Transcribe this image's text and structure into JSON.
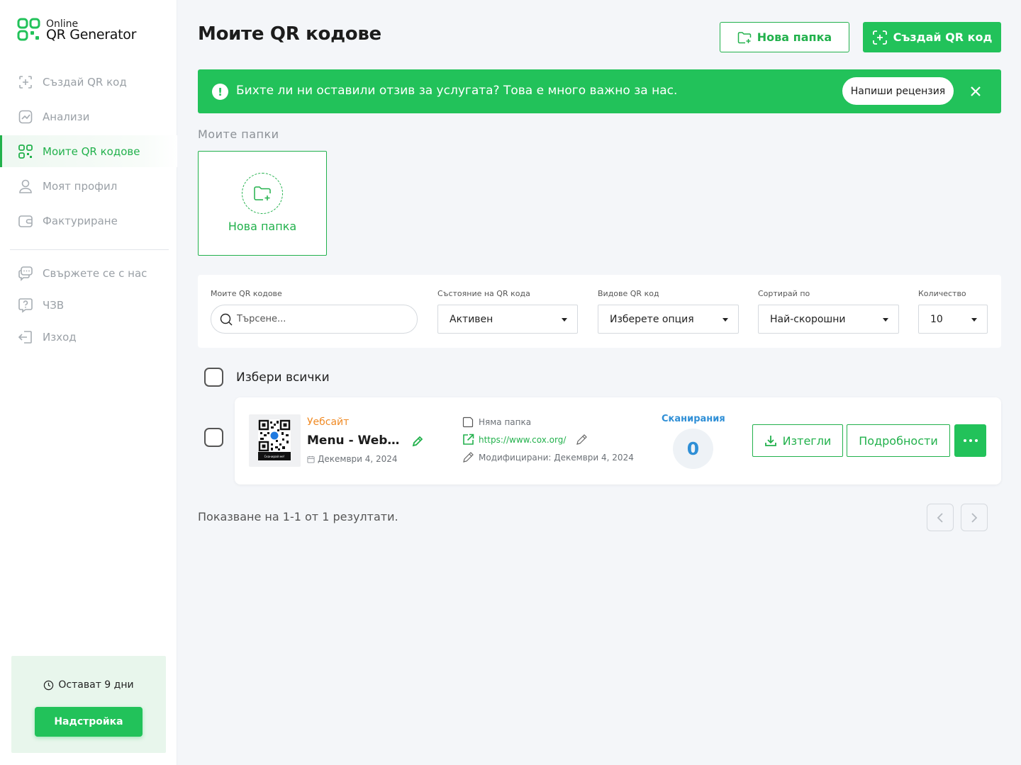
{
  "brand": {
    "line1": "Online",
    "line2": "QR Generator",
    "accent": "#22c25a",
    "info_blue": "#2f8fd6",
    "type_orange": "#f08a24"
  },
  "nav": {
    "items": [
      {
        "label": "Създай QR код",
        "icon": "plus-square-icon"
      },
      {
        "label": "Анализи",
        "icon": "chart-icon"
      },
      {
        "label": "Моите QR кодове",
        "icon": "qr-icon",
        "active": true
      },
      {
        "label": "Моят профил",
        "icon": "user-icon"
      },
      {
        "label": "Фактуриране",
        "icon": "wallet-icon"
      }
    ],
    "secondary": [
      {
        "label": "Свържете се с нас",
        "icon": "chat-icon"
      },
      {
        "label": "ЧЗВ",
        "icon": "help-icon"
      },
      {
        "label": "Изход",
        "icon": "logout-icon"
      }
    ]
  },
  "trial": {
    "text": "Остават 9 дни",
    "button": "Надстройка"
  },
  "header": {
    "title": "Моите QR кодове",
    "new_folder": "Нова папка",
    "create": "Създай QR код"
  },
  "banner": {
    "text": "Бихте ли ни оставили отзив за услугата? Това е много важно за нас.",
    "button": "Напиши рецензия"
  },
  "folders": {
    "label": "Моите папки",
    "new_folder": "Нова папка"
  },
  "filters": {
    "search_label": "Моите QR кодове",
    "search_placeholder": "Търсене...",
    "status_label": "Състояние на QR кода",
    "status_value": "Активен",
    "type_label": "Видове QR код",
    "type_value": "Изберете опция",
    "sort_label": "Сортирай по",
    "sort_value": "Най-скорошни",
    "count_label": "Количество",
    "count_value": "10"
  },
  "select_all": "Избери всички",
  "qr_item": {
    "type": "Уебсайт",
    "name": "Menu - Website",
    "created": "Декември 4, 2024",
    "folder": "Няма папка",
    "url": "https://www.cox.org/",
    "modified": "Модифицирани: Декември 4, 2024",
    "scans_label": "Сканирания",
    "scans": "0",
    "download": "Изтегли",
    "details": "Подробности",
    "thumb_caption": "Сканирай ме!"
  },
  "results": "Показване на 1-1 от 1 резултати."
}
